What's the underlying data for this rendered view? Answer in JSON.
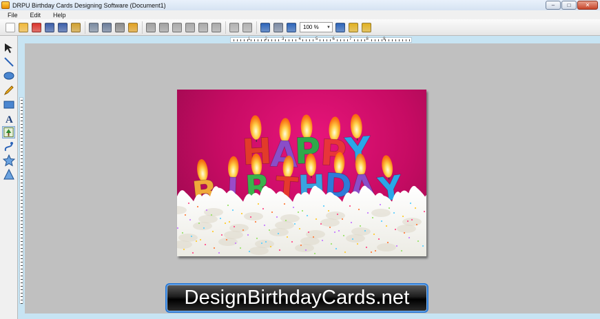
{
  "window": {
    "title": "DRPU Birthday Cards Designing Software  (Document1)",
    "controls": {
      "minimize": "–",
      "maximize": "□",
      "close": "✕"
    }
  },
  "menu": [
    "File",
    "Edit",
    "Help"
  ],
  "toolbar": {
    "zoom_value": "100 %",
    "buttons": [
      {
        "name": "new-document-icon",
        "color": "#ffffff"
      },
      {
        "name": "open-folder-icon",
        "color": "#f0b83a"
      },
      {
        "name": "close-document-icon",
        "color": "#d9342b"
      },
      {
        "name": "save-icon",
        "color": "#3b5ea8"
      },
      {
        "name": "save-as-icon",
        "color": "#3b5ea8"
      },
      {
        "name": "properties-icon",
        "color": "#d0a030"
      },
      {
        "name": "print-icon",
        "color": "#7a8aa0"
      },
      {
        "name": "export-icon",
        "color": "#6a7c99"
      },
      {
        "name": "database-icon",
        "color": "#8b8b8b"
      },
      {
        "name": "open-image-icon",
        "color": "#e0a020"
      },
      {
        "name": "undo-icon",
        "color": "#a0a0a0"
      },
      {
        "name": "redo-icon",
        "color": "#a0a0a0"
      },
      {
        "name": "copy-icon",
        "color": "#a8a8a8"
      },
      {
        "name": "cut-icon",
        "color": "#a8a8a8"
      },
      {
        "name": "paste-icon",
        "color": "#a8a8a8"
      },
      {
        "name": "delete-icon",
        "color": "#a8a8a8"
      },
      {
        "name": "group-icon",
        "color": "#b0b0b0"
      },
      {
        "name": "ungroup-icon",
        "color": "#b0b0b0"
      },
      {
        "name": "grid-icon",
        "color": "#2b63b8"
      },
      {
        "name": "snap-grid-icon",
        "color": "#7b8aa3"
      },
      {
        "name": "zoom-in-icon",
        "color": "#2b63b8"
      },
      {
        "name": "zoom-out-icon",
        "color": "#2b63b8"
      },
      {
        "name": "lock-icon",
        "color": "#e0b020"
      },
      {
        "name": "unlock-icon",
        "color": "#e0b020"
      }
    ]
  },
  "ruler": {
    "numbers": [
      "1",
      "2",
      "3",
      "4",
      "5",
      "6",
      "7",
      "8",
      "9"
    ]
  },
  "tools": [
    {
      "name": "select-arrow-icon"
    },
    {
      "name": "line-tool-icon"
    },
    {
      "name": "ellipse-tool-icon"
    },
    {
      "name": "pencil-tool-icon"
    },
    {
      "name": "rectangle-tool-icon"
    },
    {
      "name": "text-tool-icon"
    },
    {
      "name": "image-tool-icon"
    },
    {
      "name": "curve-tool-icon"
    },
    {
      "name": "star-tool-icon"
    },
    {
      "name": "triangle-tool-icon"
    }
  ],
  "card": {
    "background": "#d21170",
    "letters_row1": [
      "H",
      "A",
      "P",
      "P",
      "Y"
    ],
    "letters_row1_colors": [
      "#e23b2a",
      "#8a4dc8",
      "#2fa84a",
      "#e8353a",
      "#2aa6e8"
    ],
    "letters_row2": [
      "B",
      "I",
      "R",
      "T",
      "H",
      "D",
      "A",
      "Y"
    ],
    "letters_row2_colors": [
      "#f0a93a",
      "#9a4bc9",
      "#3ab24d",
      "#e5392d",
      "#3aa3e0",
      "#2f7ad8",
      "#8a4dc8",
      "#2aa6e8"
    ]
  },
  "banner": {
    "text": "DesignBirthdayCards.net"
  }
}
